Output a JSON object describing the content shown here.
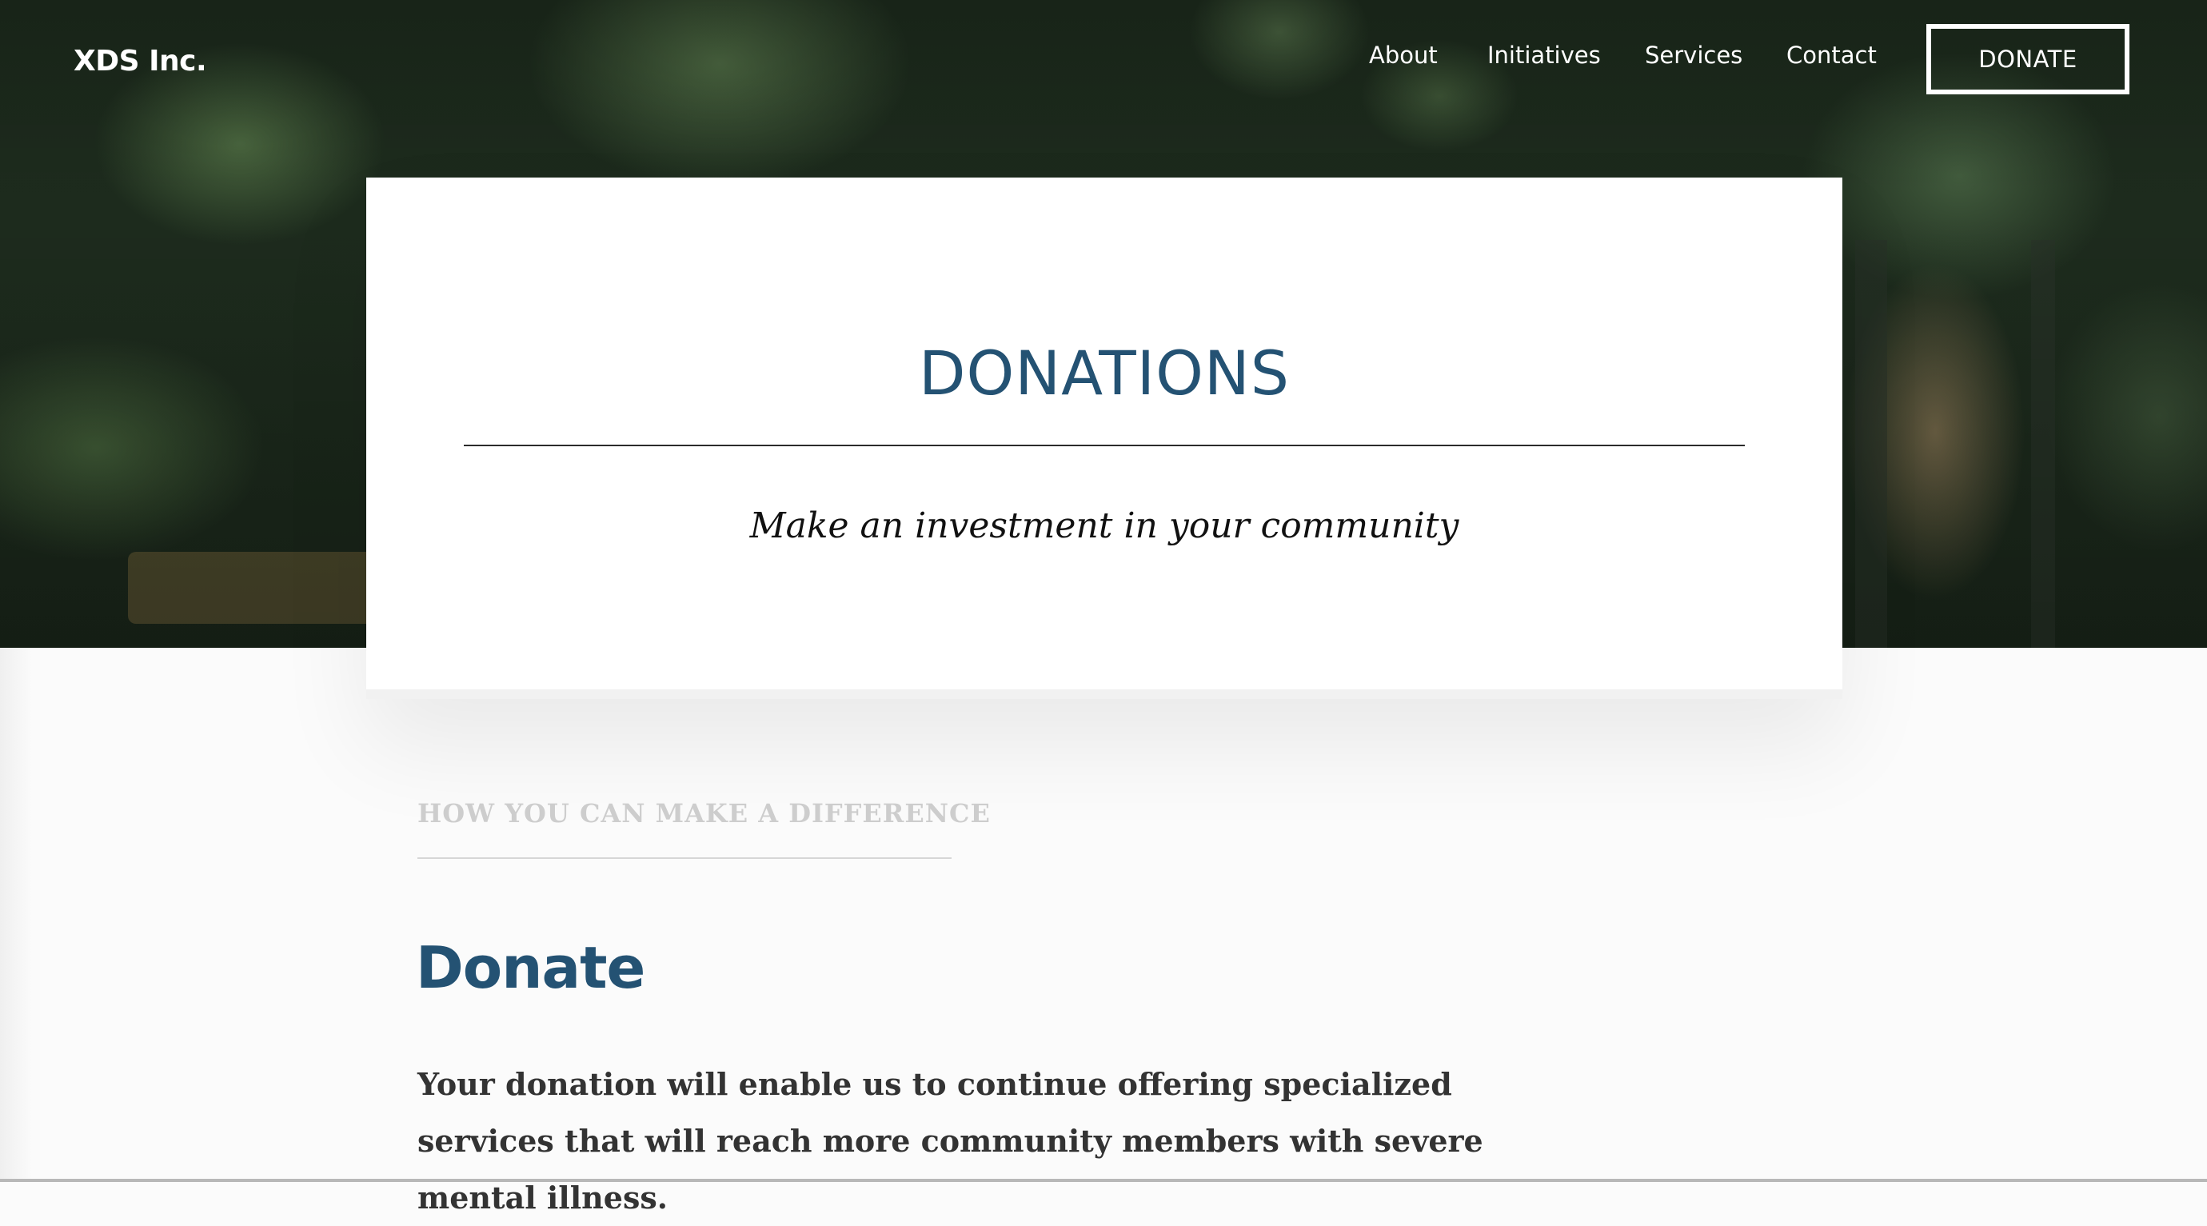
{
  "header": {
    "brand": "XDS Inc.",
    "nav": [
      "About",
      "Initiatives",
      "Services",
      "Contact"
    ],
    "donate_button": "DONATE"
  },
  "hero_card": {
    "title": "DONATIONS",
    "subtitle": "Make an investment in your community"
  },
  "content": {
    "eyebrow": "HOW YOU CAN MAKE A DIFFERENCE",
    "heading": "Donate",
    "body": "Your donation will enable us to continue offering specialized services that will reach more community members with severe mental illness."
  },
  "colors": {
    "accent": "#245273",
    "eyebrow": "#cdcdcd",
    "text": "#333333"
  }
}
